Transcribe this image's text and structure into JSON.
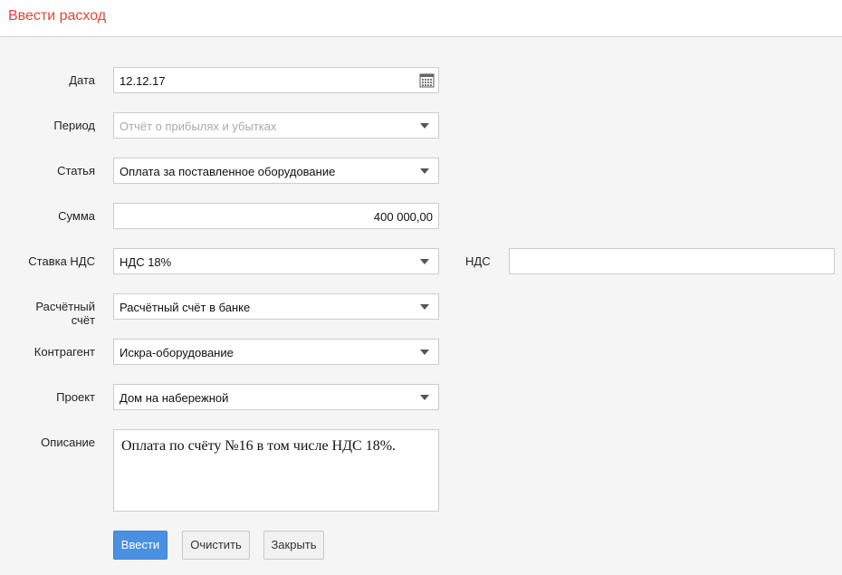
{
  "header": {
    "title": "Ввести расход"
  },
  "form": {
    "date": {
      "label": "Дата",
      "value": "12.12.17",
      "icon": "calendar-icon"
    },
    "period": {
      "label": "Период",
      "placeholder": "Отчёт о прибылях и убытках"
    },
    "article": {
      "label": "Статья",
      "value": "Оплата за поставленное оборудование"
    },
    "amount": {
      "label": "Сумма",
      "value": "400 000,00"
    },
    "vat_rate": {
      "label": "Ставка НДС",
      "value": "НДС 18%"
    },
    "vat": {
      "label": "НДС",
      "value": ""
    },
    "account": {
      "label": "Расчётный счёт",
      "value": "Расчётный счёт в банке"
    },
    "counterparty": {
      "label": "Контрагент",
      "value": "Искра-оборудование"
    },
    "project": {
      "label": "Проект",
      "value": "Дом на набережной"
    },
    "description": {
      "label": "Описание",
      "value": "Оплата по счёту №16 в том числе НДС 18%."
    }
  },
  "buttons": {
    "submit": "Ввести",
    "clear": "Очистить",
    "close": "Закрыть"
  },
  "colors": {
    "title": "#e0463a",
    "primary_button": "#4a90e2"
  }
}
